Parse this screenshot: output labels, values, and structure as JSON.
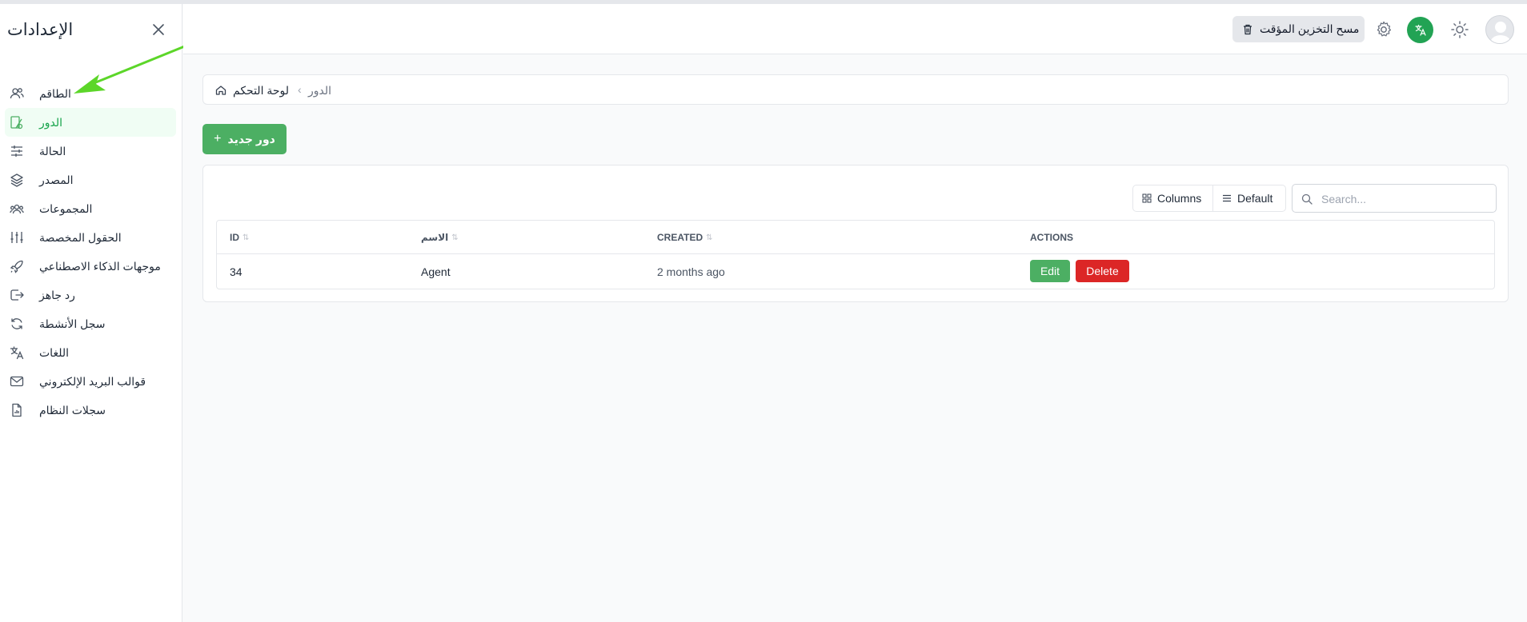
{
  "sidebar": {
    "title": "الإعدادات",
    "items": [
      {
        "label": "الطاقم",
        "icon": "users-icon",
        "active": false
      },
      {
        "label": "الدور",
        "icon": "role-icon",
        "active": true
      },
      {
        "label": "الحالة",
        "icon": "sliders-icon",
        "active": false
      },
      {
        "label": "المصدر",
        "icon": "layers-icon",
        "active": false
      },
      {
        "label": "المجموعات",
        "icon": "group-icon",
        "active": false
      },
      {
        "label": "الحقول المخصصة",
        "icon": "adjustments-icon",
        "active": false
      },
      {
        "label": "موجهات الذكاء الاصطناعي",
        "icon": "rocket-icon",
        "active": false
      },
      {
        "label": "رد جاهز",
        "icon": "reply-icon",
        "active": false
      },
      {
        "label": "سجل الأنشطة",
        "icon": "refresh-icon",
        "active": false
      },
      {
        "label": "اللغات",
        "icon": "translate-icon",
        "active": false
      },
      {
        "label": "قوالب البريد الإلكتروني",
        "icon": "mail-icon",
        "active": false
      },
      {
        "label": "سجلات النظام",
        "icon": "file-icon",
        "active": false
      }
    ]
  },
  "topbar": {
    "clear_cache_label": "مسح التخزين المؤقت"
  },
  "breadcrumb": {
    "dashboard": "لوحة التحكم",
    "current": "الدور"
  },
  "toolbar": {
    "new_label": "دور جديد",
    "columns_label": "Columns",
    "default_label": "Default",
    "search_placeholder": "Search..."
  },
  "table": {
    "headers": {
      "id": "ID",
      "name": "الاسم",
      "created": "CREATED",
      "actions": "ACTIONS"
    },
    "rows": [
      {
        "id": "34",
        "name": "Agent",
        "created": "2 months ago",
        "edit": "Edit",
        "delete": "Delete"
      }
    ]
  },
  "colors": {
    "accent": "#4caf63",
    "danger": "#dc2626",
    "active_bg": "#f0fdf4",
    "annotation_arrow": "#5cd629"
  }
}
